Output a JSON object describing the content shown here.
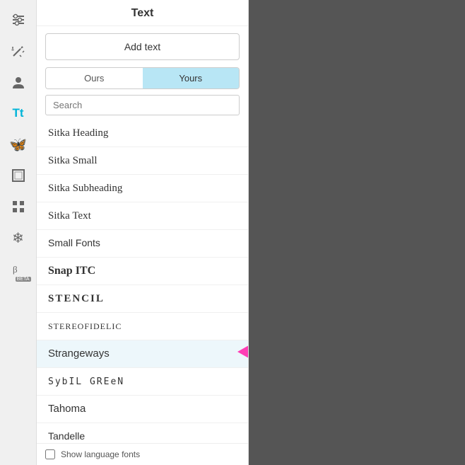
{
  "sidebar": {
    "icons": [
      {
        "name": "sliders-icon",
        "symbol": "⚙",
        "label": "Sliders",
        "active": false
      },
      {
        "name": "magic-wand-icon",
        "symbol": "✦",
        "label": "Magic Wand",
        "active": false
      },
      {
        "name": "avatar-icon",
        "symbol": "👤",
        "label": "Avatar",
        "active": false
      },
      {
        "name": "text-icon",
        "symbol": "Tt",
        "label": "Text",
        "active": true
      },
      {
        "name": "butterfly-icon",
        "symbol": "🦋",
        "label": "Butterfly",
        "active": false
      },
      {
        "name": "frame-icon",
        "symbol": "⬜",
        "label": "Frame",
        "active": false
      },
      {
        "name": "grid-icon",
        "symbol": "⊞",
        "label": "Grid",
        "active": false
      },
      {
        "name": "snowflake-icon",
        "symbol": "❄",
        "label": "Snowflake",
        "active": false
      },
      {
        "name": "beta-icon",
        "symbol": "β",
        "label": "Beta",
        "active": false,
        "beta": true
      }
    ]
  },
  "panel": {
    "title": "Text",
    "add_text_label": "Add text",
    "tabs": [
      {
        "id": "ours",
        "label": "Ours",
        "active": false
      },
      {
        "id": "yours",
        "label": "Yours",
        "active": true
      }
    ],
    "search_placeholder": "Search",
    "fonts": [
      {
        "name": "Sitka Heading",
        "class": "font-sitka-heading"
      },
      {
        "name": "Sitka Small",
        "class": "font-sitka-small"
      },
      {
        "name": "Sitka Subheading",
        "class": "font-sitka-subheading"
      },
      {
        "name": "Sitka Text",
        "class": "font-sitka-text"
      },
      {
        "name": "Small Fonts",
        "class": "font-small-fonts"
      },
      {
        "name": "Snap ITC",
        "class": "font-snap-itc"
      },
      {
        "name": "STENCIL",
        "class": "font-stencil"
      },
      {
        "name": "SteREoFidELic",
        "class": "font-stereofidelic"
      },
      {
        "name": "Strangeways",
        "class": "font-strangeways",
        "highlighted": true,
        "arrow": true
      },
      {
        "name": "SybIL GREeN",
        "class": "font-sybil-green"
      },
      {
        "name": "Tahoma",
        "class": "font-tahoma"
      },
      {
        "name": "Tandelle",
        "class": "font-tandelle"
      }
    ],
    "footer": {
      "checkbox_label": "Show language fonts"
    }
  },
  "colors": {
    "active_tab_bg": "#b8e6f5",
    "arrow_color": "#ff3eb5"
  }
}
